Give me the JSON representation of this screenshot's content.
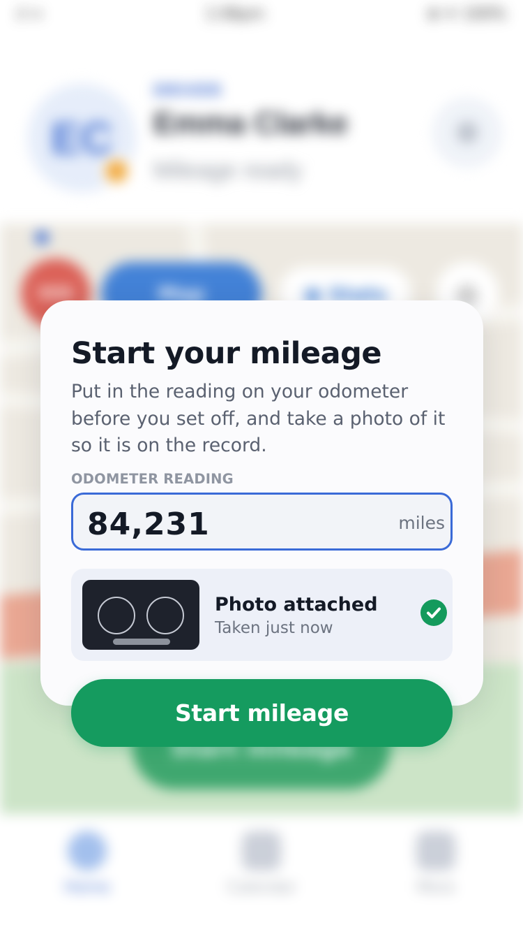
{
  "status_bar": {
    "left": "ıl ≈",
    "center": "1:06pm",
    "right": "⊕ ✈ 100%"
  },
  "background": {
    "profile": {
      "initials": "EC",
      "role": "DRIVER",
      "name": "Emma Clarke",
      "status": "Mileage ready",
      "status_color": "#f0a431"
    },
    "map": {
      "sos_label": "SOS",
      "chip_primary": "Map",
      "chip_secondary": "▣ Stats",
      "locate_icon": "locate-icon",
      "cta_label": "Start mileage"
    },
    "tabs": [
      {
        "label": "Home",
        "icon": "home-icon",
        "active": true
      },
      {
        "label": "Calendar",
        "icon": "calendar-icon",
        "active": false
      },
      {
        "label": "More",
        "icon": "more-icon",
        "active": false
      }
    ]
  },
  "modal": {
    "title": "Start your mileage",
    "description": "Put in the reading on your odometer before you set off, and take a photo of it so it is on the record.",
    "field_label": "ODOMETER READING",
    "odometer_value": "84,231",
    "odometer_unit": "miles",
    "photo": {
      "title": "Photo attached",
      "subtitle": "Taken just now",
      "thumbnail_icon": "odometer-photo-icon",
      "status_icon": "check-circle-icon"
    },
    "primary_button": "Start mileage"
  },
  "colors": {
    "accent_blue": "#3a6ad7",
    "success_green": "#159b5f",
    "card_background": "#fbfbfd"
  }
}
